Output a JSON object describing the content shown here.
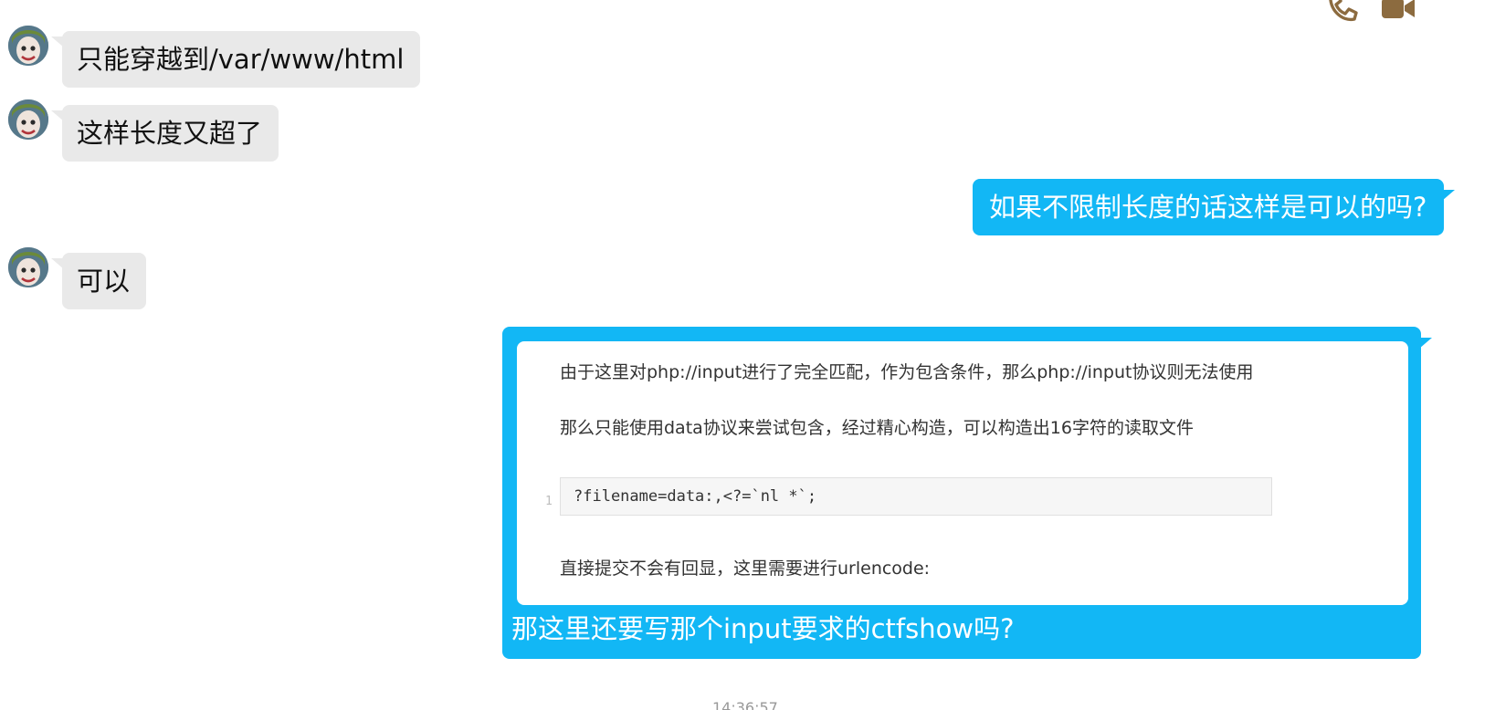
{
  "header": {
    "voice_call_icon": "phone-icon",
    "video_call_icon": "video-camera-icon",
    "icon_color": "#8c6b3f"
  },
  "colors": {
    "incoming_bubble": "#e9e9e9",
    "outgoing_bubble": "#12b7f5"
  },
  "messages": [
    {
      "direction": "incoming",
      "text": "只能穿越到/var/www/html"
    },
    {
      "direction": "incoming",
      "text": "这样长度又超了"
    },
    {
      "direction": "outgoing",
      "text": "如果不限制长度的话这样是可以的吗?"
    },
    {
      "direction": "incoming",
      "text": "可以"
    },
    {
      "direction": "outgoing",
      "quote": {
        "line1": "由于这里对php://input进行了完全匹配，作为包含条件，那么php://input协议则无法使用",
        "line2": "那么只能使用data协议来尝试包含，经过精心构造，可以构造出16字符的读取文件",
        "code_line_number": "1",
        "code": "?filename=data:,<?=`nl *`;",
        "line3": "直接提交不会有回显，这里需要进行urlencode:"
      },
      "text": "那这里还要写那个input要求的ctfshow吗?"
    }
  ],
  "timestamp": "14:36:57"
}
